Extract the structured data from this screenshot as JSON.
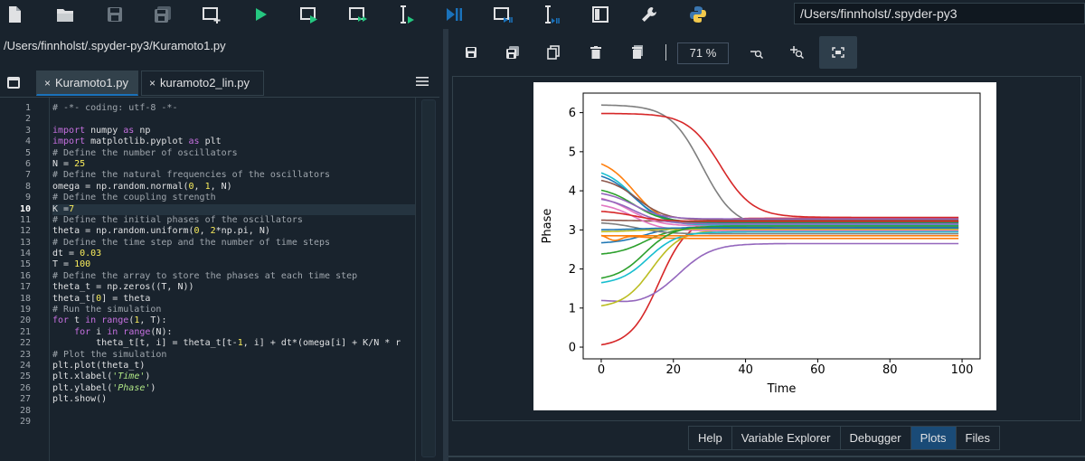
{
  "toolbar": {
    "buttons": [
      {
        "name": "new-file-icon"
      },
      {
        "name": "open-folder-icon"
      },
      {
        "name": "save-icon"
      },
      {
        "name": "save-all-icon"
      },
      {
        "name": "new-cell-icon"
      },
      {
        "name": "run-icon"
      },
      {
        "name": "run-cell-icon"
      },
      {
        "name": "run-cell-advance-icon"
      },
      {
        "name": "run-selection-icon"
      },
      {
        "name": "debug-icon"
      },
      {
        "name": "debug-cell-icon"
      },
      {
        "name": "debug-selection-icon"
      },
      {
        "name": "maximize-pane-icon"
      },
      {
        "name": "preferences-wrench-icon"
      },
      {
        "name": "python-path-icon"
      }
    ],
    "working_directory": "/Users/finnholst/.spyder-py3"
  },
  "editor": {
    "file_path": "/Users/finnholst/.spyder-py3/Kuramoto1.py",
    "tabs": [
      {
        "label": "Kuramoto1.py",
        "close": "×"
      },
      {
        "label": "kuramoto2_lin.py",
        "close": "×"
      }
    ],
    "current_line": 10,
    "line_numbers": [
      "1",
      "2",
      "3",
      "4",
      "5",
      "6",
      "7",
      "8",
      "9",
      "10",
      "11",
      "12",
      "13",
      "14",
      "15",
      "16",
      "17",
      "18",
      "19",
      "20",
      "21",
      "22",
      "23",
      "24",
      "25",
      "26",
      "27",
      "28",
      "29"
    ],
    "code": [
      "# -*- coding: utf-8 -*-",
      "",
      "import numpy as np",
      "import matplotlib.pyplot as plt",
      "# Define the number of oscillators",
      "N = 25",
      "# Define the natural frequencies of the oscillators",
      "omega = np.random.normal(0, 1, N)",
      "# Define the coupling strength",
      "K =7",
      "# Define the initial phases of the oscillators",
      "theta = np.random.uniform(0, 2*np.pi, N)",
      "# Define the time step and the number of time steps",
      "dt = 0.03",
      "T = 100",
      "# Define the array to store the phases at each time step",
      "theta_t = np.zeros((T, N))",
      "theta_t[0] = theta",
      "# Run the simulation",
      "for t in range(1, T):",
      "    for i in range(N):",
      "        theta_t[t, i] = theta_t[t-1, i] + dt*(omega[i] + K/N * r",
      "# Plot the simulation",
      "plt.plot(theta_t)",
      "plt.xlabel('Time')",
      "plt.ylabel('Phase')",
      "plt.show()",
      "",
      ""
    ]
  },
  "plots": {
    "toolbar": {
      "buttons": [
        {
          "name": "save-plot-icon"
        },
        {
          "name": "save-all-plots-icon"
        },
        {
          "name": "copy-plot-icon"
        },
        {
          "name": "remove-plot-icon"
        },
        {
          "name": "remove-all-plots-icon"
        }
      ],
      "zoom": "71 %",
      "zoom_out_icon": "zoom-out-icon",
      "zoom_in_icon": "zoom-in-icon",
      "fit_icon": "fit-to-pane-icon"
    },
    "bottom_tabs": [
      {
        "label": "Help",
        "active": false
      },
      {
        "label": "Variable Explorer",
        "active": false
      },
      {
        "label": "Debugger",
        "active": false
      },
      {
        "label": "Plots",
        "active": true
      },
      {
        "label": "Files",
        "active": false
      }
    ]
  },
  "chart_data": {
    "type": "line",
    "xlabel": "Time",
    "ylabel": "Phase",
    "xlim": [
      -5,
      105
    ],
    "ylim": [
      -0.3,
      6.5
    ],
    "xticks": [
      0,
      20,
      40,
      60,
      80,
      100
    ],
    "yticks": [
      0,
      1,
      2,
      3,
      4,
      5,
      6
    ],
    "grid": false,
    "series": [
      {
        "color": "#1f77b4",
        "start": 2.65,
        "final": 3.08,
        "mid": 12
      },
      {
        "color": "#ff7f0e",
        "start": 4.85,
        "final": 3.15,
        "mid": 9
      },
      {
        "color": "#2ca02c",
        "start": 2.35,
        "final": 3.05,
        "mid": 12
      },
      {
        "color": "#d62728",
        "start": 0.0,
        "final": 3.3,
        "mid": 16
      },
      {
        "color": "#9467bd",
        "start": 1.2,
        "final": 2.65,
        "mid": 22,
        "dip": 1.05
      },
      {
        "color": "#8c564b",
        "start": 3.25,
        "final": 3.22,
        "mid": 10
      },
      {
        "color": "#e377c2",
        "start": 3.9,
        "final": 3.1,
        "mid": 8
      },
      {
        "color": "#7f7f7f",
        "start": 6.2,
        "final": 3.05,
        "mid": 28
      },
      {
        "color": "#bcbd22",
        "start": 1.0,
        "final": 3.0,
        "mid": 14
      },
      {
        "color": "#17becf",
        "start": 4.6,
        "final": 3.12,
        "mid": 9
      },
      {
        "color": "#1f77b4",
        "start": 4.5,
        "final": 3.18,
        "mid": 9
      },
      {
        "color": "#ff7f0e",
        "start": 2.9,
        "final": 2.78,
        "mid": 8,
        "dip": 2.55
      },
      {
        "color": "#2ca02c",
        "start": 4.1,
        "final": 3.2,
        "mid": 9
      },
      {
        "color": "#d62728",
        "start": 5.98,
        "final": 3.32,
        "mid": 33
      },
      {
        "color": "#9467bd",
        "start": 3.85,
        "final": 3.15,
        "mid": 9
      },
      {
        "color": "#8c564b",
        "start": 4.35,
        "final": 3.25,
        "mid": 10
      },
      {
        "color": "#e377c2",
        "start": 3.7,
        "final": 2.98,
        "mid": 9
      },
      {
        "color": "#7f7f7f",
        "start": 3.2,
        "final": 2.9,
        "mid": 10
      },
      {
        "color": "#bcbd22",
        "start": 2.95,
        "final": 3.02,
        "mid": 10
      },
      {
        "color": "#17becf",
        "start": 1.6,
        "final": 2.95,
        "mid": 13
      },
      {
        "color": "#1f77b4",
        "start": 3.0,
        "final": 3.05,
        "mid": 10
      },
      {
        "color": "#ff7f0e",
        "start": 2.85,
        "final": 2.85,
        "mid": 10
      },
      {
        "color": "#2ca02c",
        "start": 1.7,
        "final": 3.1,
        "mid": 12
      },
      {
        "color": "#d62728",
        "start": 3.5,
        "final": 3.22,
        "mid": 9
      },
      {
        "color": "#9467bd",
        "start": 4.0,
        "final": 3.28,
        "mid": 9
      }
    ]
  }
}
